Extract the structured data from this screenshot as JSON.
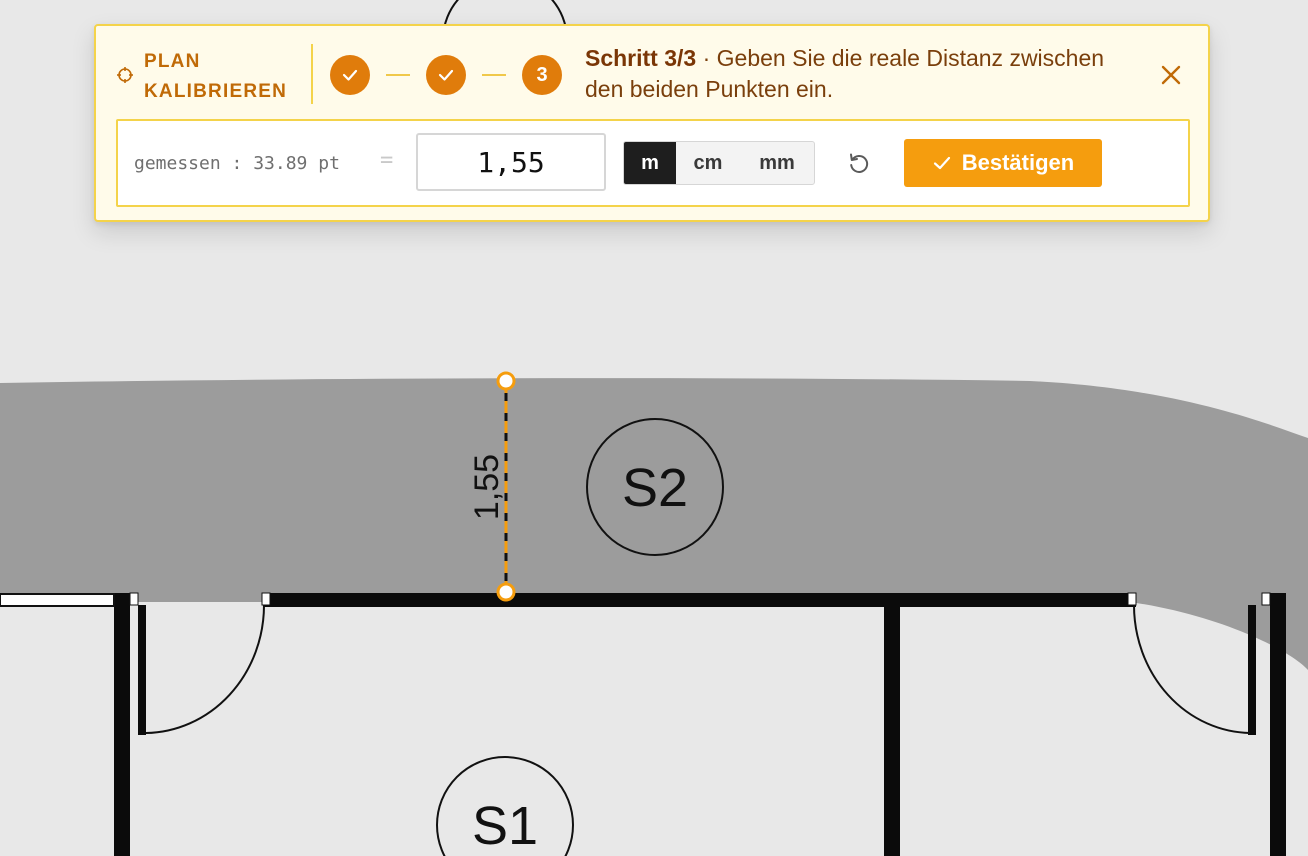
{
  "toolbar": {
    "title": "PLAN KALIBRIEREN",
    "steps": [
      {
        "state": "done",
        "label": ""
      },
      {
        "state": "done",
        "label": ""
      },
      {
        "state": "active",
        "label": "3"
      }
    ],
    "step_counter": "Schritt 3/3",
    "step_separator": " · ",
    "instruction": "Geben Sie die reale Distanz zwischen den beiden Punkten ein.",
    "measured_text": "gemessen : 33.89 pt",
    "equals_sign": "=",
    "distance_value": "1,55",
    "units": [
      "m",
      "cm",
      "mm"
    ],
    "selected_unit": "m",
    "confirm_label": "Bestätigen"
  },
  "plan": {
    "rooms": [
      "S2",
      "S1"
    ],
    "dimension_label": "1,55"
  },
  "colors": {
    "accent": "#f59d0e",
    "step_circle": "#e07c0b",
    "panel_background": "#fffbea",
    "panel_border": "#f4d34a",
    "title_text": "#c06a07",
    "instruction_text": "#7a3f0c",
    "corridor": "#9c9c9c",
    "plan_background": "#e8e8e8"
  },
  "icons": {
    "title": "crosshair-icon",
    "step_done": "check-icon",
    "close": "close-icon",
    "reset": "reset-icon",
    "confirm": "check-icon"
  }
}
